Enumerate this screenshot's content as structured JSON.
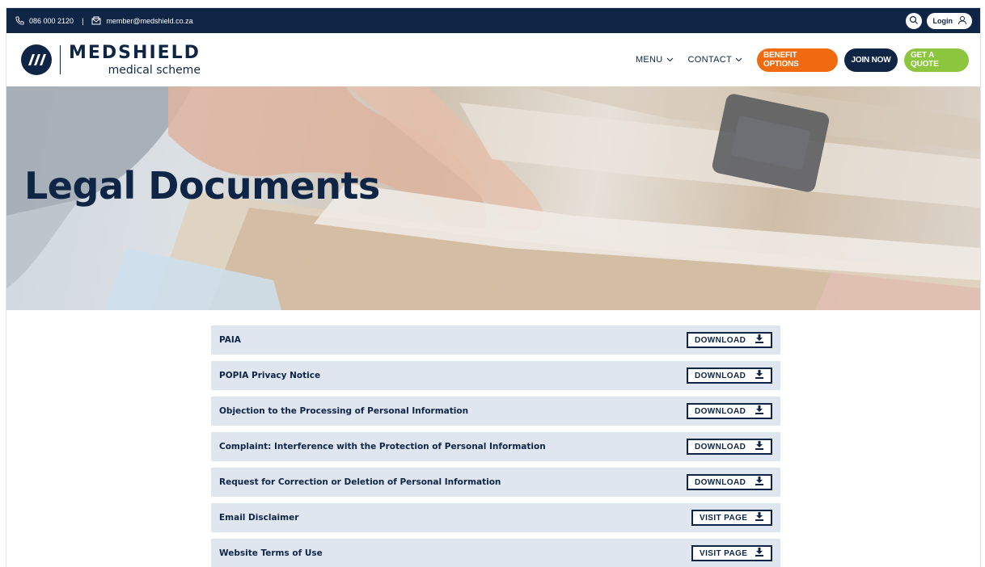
{
  "topbar": {
    "phone": "086 000 2120",
    "separator": "|",
    "email": "member@medshield.co.za",
    "login_label": "Login",
    "icons": {
      "phone": "phone-icon",
      "email": "email-icon",
      "search": "search-icon",
      "user": "user-icon"
    }
  },
  "header": {
    "logo_name": "MEDSHIELD",
    "logo_sub": "medical scheme",
    "nav": [
      {
        "label": "MENU"
      },
      {
        "label": "CONTACT"
      }
    ],
    "buttons": {
      "benefit": "BENEFIT OPTIONS",
      "join": "JOIN NOW",
      "quote": "GET A QUOTE"
    }
  },
  "hero": {
    "title": "Legal Documents"
  },
  "documents": [
    {
      "title": "PAIA",
      "action": "DOWNLOAD"
    },
    {
      "title": "POPIA Privacy Notice",
      "action": "DOWNLOAD"
    },
    {
      "title": "Objection to the Processing of Personal Information",
      "action": "DOWNLOAD"
    },
    {
      "title": "Complaint: Interference with the Protection of Personal Information",
      "action": "DOWNLOAD"
    },
    {
      "title": "Request for Correction or Deletion of Personal Information",
      "action": "DOWNLOAD"
    },
    {
      "title": "Email Disclaimer",
      "action": "VISIT PAGE"
    },
    {
      "title": "Website Terms of Use",
      "action": "VISIT PAGE"
    }
  ],
  "colors": {
    "navy": "#0f2545",
    "orange": "#f26a10",
    "green": "#8cc63f",
    "row_bg": "#dfe6f0"
  }
}
